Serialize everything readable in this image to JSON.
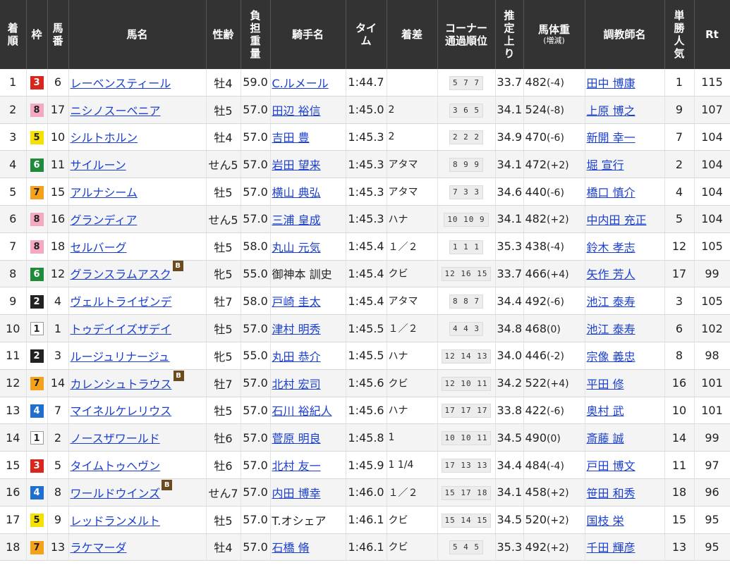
{
  "headers": {
    "rank": "着順",
    "waku": "枠",
    "umaban": "馬番",
    "horse": "馬名",
    "sexage": "性齢",
    "weight": "負担重量",
    "jockey": "騎手名",
    "time": "タイム",
    "margin": "着差",
    "corner_main": "コーナー",
    "corner_sub": "通過順位",
    "last3f": "推定上り",
    "bodyweight_main": "馬体重",
    "bodyweight_sub": "(増減)",
    "trainer": "調教師名",
    "popularity": "単勝人気",
    "rating": "Rt"
  },
  "colors": {
    "header_bg": "#333333",
    "link": "#1a3fd1",
    "waku_1": "#ffffff",
    "waku_2": "#222222",
    "waku_3": "#d9261c",
    "waku_4": "#1f6fd1",
    "waku_5": "#f5e000",
    "waku_6": "#1f8a3a",
    "waku_7": "#f5a21a",
    "waku_8": "#f4a9c0",
    "blinker_icon": "#6b4a1e"
  },
  "rows": [
    {
      "rank": "1",
      "waku": "3",
      "umaban": "6",
      "horse": "レーベンスティール",
      "blinker": "",
      "sexage": "牡4",
      "weight": "59.0",
      "jockey": "C.ルメール",
      "jockey_link": true,
      "time": "1:44.7",
      "margin": "",
      "corner": "5 7 7",
      "last3f": "33.7",
      "bw": "482",
      "bwchg": "(-4)",
      "trainer": "田中 博康",
      "pop": "1",
      "rt": "115"
    },
    {
      "rank": "2",
      "waku": "8",
      "umaban": "17",
      "horse": "ニシノスーベニア",
      "blinker": "",
      "sexage": "牡5",
      "weight": "57.0",
      "jockey": "田辺 裕信",
      "jockey_link": true,
      "time": "1:45.0",
      "margin": "2",
      "corner": "3 6 5",
      "last3f": "34.1",
      "bw": "524",
      "bwchg": "(-8)",
      "trainer": "上原 博之",
      "pop": "9",
      "rt": "107"
    },
    {
      "rank": "3",
      "waku": "5",
      "umaban": "10",
      "horse": "シルトホルン",
      "blinker": "",
      "sexage": "牡4",
      "weight": "57.0",
      "jockey": "吉田 豊",
      "jockey_link": true,
      "time": "1:45.3",
      "margin": "2",
      "corner": "2 2 2",
      "last3f": "34.9",
      "bw": "470",
      "bwchg": "(-6)",
      "trainer": "新開 幸一",
      "pop": "7",
      "rt": "104"
    },
    {
      "rank": "4",
      "waku": "6",
      "umaban": "11",
      "horse": "サイルーン",
      "blinker": "",
      "sexage": "せん5",
      "weight": "57.0",
      "jockey": "岩田 望来",
      "jockey_link": true,
      "time": "1:45.3",
      "margin": "アタマ",
      "corner": "8 9 9",
      "last3f": "34.1",
      "bw": "472",
      "bwchg": "(+2)",
      "trainer": "堀 宣行",
      "pop": "2",
      "rt": "104"
    },
    {
      "rank": "5",
      "waku": "7",
      "umaban": "15",
      "horse": "アルナシーム",
      "blinker": "",
      "sexage": "牡5",
      "weight": "57.0",
      "jockey": "横山 典弘",
      "jockey_link": true,
      "time": "1:45.3",
      "margin": "アタマ",
      "corner": "7 3 3",
      "last3f": "34.6",
      "bw": "440",
      "bwchg": "(-6)",
      "trainer": "橋口 慎介",
      "pop": "4",
      "rt": "104"
    },
    {
      "rank": "6",
      "waku": "8",
      "umaban": "16",
      "horse": "グランディア",
      "blinker": "",
      "sexage": "せん5",
      "weight": "57.0",
      "jockey": "三浦 皇成",
      "jockey_link": true,
      "time": "1:45.3",
      "margin": "ハナ",
      "corner": "10 10 9",
      "last3f": "34.1",
      "bw": "482",
      "bwchg": "(+2)",
      "trainer": "中内田 充正",
      "pop": "5",
      "rt": "104"
    },
    {
      "rank": "7",
      "waku": "8",
      "umaban": "18",
      "horse": "セルバーグ",
      "blinker": "",
      "sexage": "牡5",
      "weight": "58.0",
      "jockey": "丸山 元気",
      "jockey_link": true,
      "time": "1:45.4",
      "margin": "１／２",
      "corner": "1 1 1",
      "last3f": "35.3",
      "bw": "438",
      "bwchg": "(-4)",
      "trainer": "鈴木 孝志",
      "pop": "12",
      "rt": "105"
    },
    {
      "rank": "8",
      "waku": "6",
      "umaban": "12",
      "horse": "グランスラムアスク",
      "blinker": "B",
      "sexage": "牝5",
      "weight": "55.0",
      "jockey": "御神本 訓史",
      "jockey_link": false,
      "time": "1:45.4",
      "margin": "クビ",
      "corner": "12 16 15",
      "last3f": "33.7",
      "bw": "466",
      "bwchg": "(+4)",
      "trainer": "矢作 芳人",
      "pop": "17",
      "rt": "99"
    },
    {
      "rank": "9",
      "waku": "2",
      "umaban": "4",
      "horse": "ヴェルトライゼンデ",
      "blinker": "",
      "sexage": "牡7",
      "weight": "58.0",
      "jockey": "戸崎 圭太",
      "jockey_link": true,
      "time": "1:45.4",
      "margin": "アタマ",
      "corner": "8 8 7",
      "last3f": "34.4",
      "bw": "492",
      "bwchg": "(-6)",
      "trainer": "池江 泰寿",
      "pop": "3",
      "rt": "105"
    },
    {
      "rank": "10",
      "waku": "1",
      "umaban": "1",
      "horse": "トゥデイイズザデイ",
      "blinker": "",
      "sexage": "牡5",
      "weight": "57.0",
      "jockey": "津村 明秀",
      "jockey_link": true,
      "time": "1:45.5",
      "margin": "１／２",
      "corner": "4 4 3",
      "last3f": "34.8",
      "bw": "468",
      "bwchg": "(0)",
      "trainer": "池江 泰寿",
      "pop": "6",
      "rt": "102"
    },
    {
      "rank": "11",
      "waku": "2",
      "umaban": "3",
      "horse": "ルージュリナージュ",
      "blinker": "",
      "sexage": "牝5",
      "weight": "55.0",
      "jockey": "丸田 恭介",
      "jockey_link": true,
      "time": "1:45.5",
      "margin": "ハナ",
      "corner": "12 14 13",
      "last3f": "34.0",
      "bw": "446",
      "bwchg": "(-2)",
      "trainer": "宗像 義忠",
      "pop": "8",
      "rt": "98"
    },
    {
      "rank": "12",
      "waku": "7",
      "umaban": "14",
      "horse": "カレンシュトラウス",
      "blinker": "B",
      "sexage": "牡7",
      "weight": "57.0",
      "jockey": "北村 宏司",
      "jockey_link": true,
      "time": "1:45.6",
      "margin": "クビ",
      "corner": "12 10 11",
      "last3f": "34.2",
      "bw": "522",
      "bwchg": "(+4)",
      "trainer": "平田 修",
      "pop": "16",
      "rt": "101"
    },
    {
      "rank": "13",
      "waku": "4",
      "umaban": "7",
      "horse": "マイネルケレリウス",
      "blinker": "",
      "sexage": "牡5",
      "weight": "57.0",
      "jockey": "石川 裕紀人",
      "jockey_link": true,
      "time": "1:45.6",
      "margin": "ハナ",
      "corner": "17 17 17",
      "last3f": "33.8",
      "bw": "422",
      "bwchg": "(-6)",
      "trainer": "奥村 武",
      "pop": "10",
      "rt": "101"
    },
    {
      "rank": "14",
      "waku": "1",
      "umaban": "2",
      "horse": "ノースザワールド",
      "blinker": "",
      "sexage": "牡6",
      "weight": "57.0",
      "jockey": "菅原 明良",
      "jockey_link": true,
      "time": "1:45.8",
      "margin": "1",
      "corner": "10 10 11",
      "last3f": "34.5",
      "bw": "490",
      "bwchg": "(0)",
      "trainer": "斎藤 誠",
      "pop": "14",
      "rt": "99"
    },
    {
      "rank": "15",
      "waku": "3",
      "umaban": "5",
      "horse": "タイムトゥヘヴン",
      "blinker": "",
      "sexage": "牡6",
      "weight": "57.0",
      "jockey": "北村 友一",
      "jockey_link": true,
      "time": "1:45.9",
      "margin": "1 1/4",
      "corner": "17 13 13",
      "last3f": "34.4",
      "bw": "484",
      "bwchg": "(-4)",
      "trainer": "戸田 博文",
      "pop": "11",
      "rt": "97"
    },
    {
      "rank": "16",
      "waku": "4",
      "umaban": "8",
      "horse": "ワールドウインズ",
      "blinker": "B",
      "sexage": "せん7",
      "weight": "57.0",
      "jockey": "内田 博幸",
      "jockey_link": true,
      "time": "1:46.0",
      "margin": "１／２",
      "corner": "15 17 18",
      "last3f": "34.1",
      "bw": "458",
      "bwchg": "(+2)",
      "trainer": "笹田 和秀",
      "pop": "18",
      "rt": "96"
    },
    {
      "rank": "17",
      "waku": "5",
      "umaban": "9",
      "horse": "レッドランメルト",
      "blinker": "",
      "sexage": "牡5",
      "weight": "57.0",
      "jockey": "T.オシェア",
      "jockey_link": false,
      "time": "1:46.1",
      "margin": "クビ",
      "corner": "15 14 15",
      "last3f": "34.5",
      "bw": "520",
      "bwchg": "(+2)",
      "trainer": "国枝 栄",
      "pop": "15",
      "rt": "95"
    },
    {
      "rank": "18",
      "waku": "7",
      "umaban": "13",
      "horse": "ラケマーダ",
      "blinker": "",
      "sexage": "牡4",
      "weight": "57.0",
      "jockey": "石橋 脩",
      "jockey_link": true,
      "time": "1:46.1",
      "margin": "クビ",
      "corner": "5 4 5",
      "last3f": "35.3",
      "bw": "492",
      "bwchg": "(+2)",
      "trainer": "千田 輝彦",
      "pop": "13",
      "rt": "95"
    }
  ]
}
